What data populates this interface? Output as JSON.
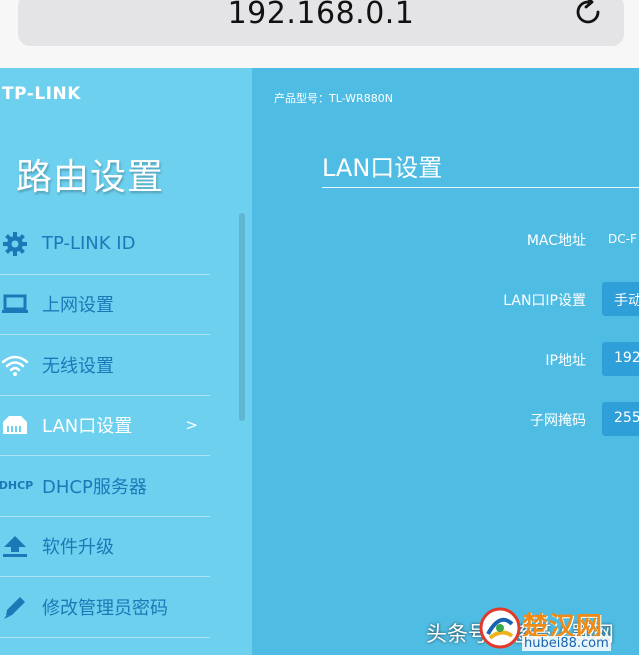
{
  "browser": {
    "url": "192.168.0.1",
    "reload_icon": "reload-icon"
  },
  "sidebar": {
    "logo": "TP-LINK",
    "title": "路由设置",
    "items": [
      {
        "label": "TP-LINK ID",
        "icon": "gear-icon"
      },
      {
        "label": "上网设置",
        "icon": "laptop-icon"
      },
      {
        "label": "无线设置",
        "icon": "wifi-icon"
      },
      {
        "label": "LAN口设置",
        "icon": "ethernet-icon",
        "active": true,
        "arrow": ">"
      },
      {
        "label": "DHCP服务器",
        "icon": "dhcp-icon",
        "icon_text_1": "DH",
        "icon_text_2": "CP"
      },
      {
        "label": "软件升级",
        "icon": "upload-icon"
      },
      {
        "label": "修改管理员密码",
        "icon": "pencil-icon"
      }
    ]
  },
  "main": {
    "model": "产品型号：TL-WR880N",
    "section_title": "LAN口设置",
    "fields": [
      {
        "label": "MAC地址",
        "value": "DC-F"
      },
      {
        "label": "LAN口IP设置",
        "value": "手动"
      },
      {
        "label": "IP地址",
        "value": "192"
      },
      {
        "label": "子网掩码",
        "value": "255"
      }
    ]
  },
  "watermark": {
    "text": "头条号 / 慈豪 / 鄂网",
    "brand": "楚汉网",
    "domain": "hubei88.com"
  },
  "colors": {
    "sidebar_bg": "#6cd0ee",
    "main_bg": "#4fbde3",
    "menu_text": "#1c79b8",
    "input_bg": "#2e9fd8"
  }
}
